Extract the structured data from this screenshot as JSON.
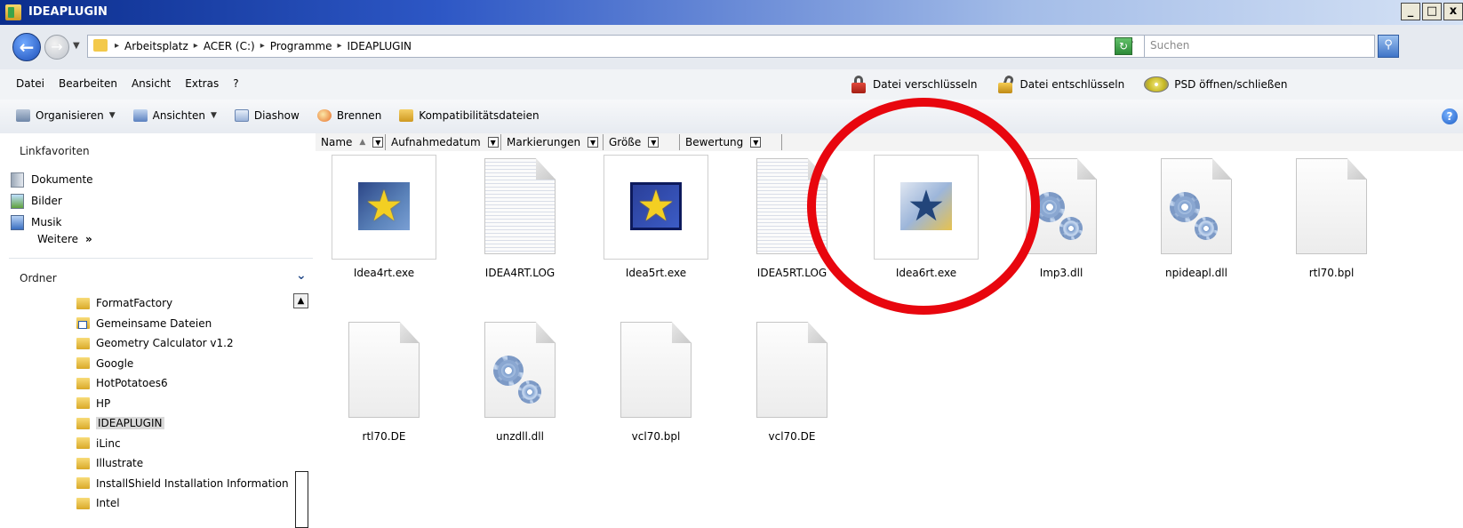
{
  "window": {
    "title": "IDEAPLUGIN",
    "buttons": [
      "_",
      "□",
      "x"
    ]
  },
  "address": {
    "crumbs": [
      "Arbeitsplatz",
      "ACER (C:)",
      "Programme",
      "IDEAPLUGIN"
    ],
    "search_placeholder": "Suchen"
  },
  "menubar": {
    "items": [
      "Datei",
      "Bearbeiten",
      "Ansicht",
      "Extras",
      "?"
    ],
    "extra_tools": [
      {
        "label": "Datei verschlüsseln",
        "icon": "lock-icon"
      },
      {
        "label": "Datei entschlüsseln",
        "icon": "unlock-icon"
      },
      {
        "label": "PSD öffnen/schließen",
        "icon": "disc-icon"
      }
    ]
  },
  "commandbar": {
    "items": [
      {
        "label": "Organisieren",
        "icon": "organize-icon",
        "has_dropdown": true
      },
      {
        "label": "Ansichten",
        "icon": "views-icon",
        "has_dropdown": true
      },
      {
        "label": "Diashow",
        "icon": "slideshow-icon",
        "has_dropdown": false
      },
      {
        "label": "Brennen",
        "icon": "burn-icon",
        "has_dropdown": false
      },
      {
        "label": "Kompatibilitätsdateien",
        "icon": "compat-folder-icon",
        "has_dropdown": false
      }
    ]
  },
  "leftpane": {
    "favorites_title": "Linkfavoriten",
    "favorites": [
      {
        "label": "Dokumente",
        "icon": "documents-icon"
      },
      {
        "label": "Bilder",
        "icon": "pictures-icon"
      },
      {
        "label": "Musik",
        "icon": "music-icon"
      }
    ],
    "more_label": "Weitere",
    "more_arrows": "»",
    "folders_title": "Ordner",
    "folders": [
      {
        "label": "FormatFactory",
        "shortcut": false,
        "selected": false
      },
      {
        "label": "Gemeinsame Dateien",
        "shortcut": true,
        "selected": false
      },
      {
        "label": "Geometry Calculator v1.2",
        "shortcut": false,
        "selected": false
      },
      {
        "label": "Google",
        "shortcut": false,
        "selected": false
      },
      {
        "label": "HotPotatoes6",
        "shortcut": false,
        "selected": false
      },
      {
        "label": "HP",
        "shortcut": false,
        "selected": false
      },
      {
        "label": "IDEAPLUGIN",
        "shortcut": false,
        "selected": true
      },
      {
        "label": "iLinc",
        "shortcut": false,
        "selected": false
      },
      {
        "label": "Illustrate",
        "shortcut": false,
        "selected": false
      },
      {
        "label": "InstallShield Installation Information",
        "shortcut": false,
        "selected": false
      },
      {
        "label": "Intel",
        "shortcut": false,
        "selected": false
      }
    ]
  },
  "columns": [
    "Name",
    "Aufnahmedatum",
    "Markierungen",
    "Größe",
    "Bewertung"
  ],
  "files": [
    {
      "name": "Idea4rt.exe",
      "type": "exe",
      "icon": "idea4-star-icon"
    },
    {
      "name": "IDEA4RT.LOG",
      "type": "log",
      "icon": "text-document-icon"
    },
    {
      "name": "Idea5rt.exe",
      "type": "exe",
      "icon": "idea5-star-icon"
    },
    {
      "name": "IDEA5RT.LOG",
      "type": "log",
      "icon": "text-document-icon"
    },
    {
      "name": "Idea6rt.exe",
      "type": "exe",
      "icon": "idea6-star-icon"
    },
    {
      "name": "Imp3.dll",
      "type": "dll",
      "icon": "gear-document-icon"
    },
    {
      "name": "npideapl.dll",
      "type": "dll",
      "icon": "gear-document-icon"
    },
    {
      "name": "rtl70.bpl",
      "type": "blank",
      "icon": "blank-document-icon"
    },
    {
      "name": "rtl70.DE",
      "type": "blank",
      "icon": "blank-document-icon"
    },
    {
      "name": "unzdll.dll",
      "type": "dll",
      "icon": "gear-document-icon"
    },
    {
      "name": "vcl70.bpl",
      "type": "blank",
      "icon": "blank-document-icon"
    },
    {
      "name": "vcl70.DE",
      "type": "blank",
      "icon": "blank-document-icon"
    }
  ],
  "colors": {
    "titlebar": "#0b2d8c",
    "highlight_ring": "#e8060e"
  }
}
